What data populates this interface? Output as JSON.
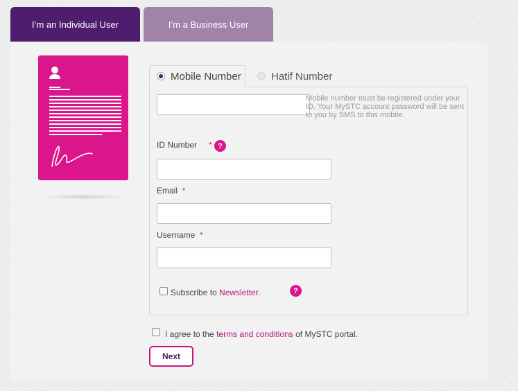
{
  "tabs": {
    "individual": "I’m an Individual User",
    "business": "I’m a Business User"
  },
  "subtabs": {
    "mobile": "Mobile Number",
    "hatif": "Hatif Number"
  },
  "form": {
    "mobile_hint": "Mobile number must be registered under your ID. Your MySTC account password will be sent to you by SMS to this mobile.",
    "id_label": "ID Number",
    "email_label": "Email",
    "username_label": "Username",
    "required_mark": "*",
    "help_glyph": "?",
    "newsletter_prefix": "Subscribe to ",
    "newsletter_link": "Newsletter",
    "newsletter_suffix": ".",
    "terms_prefix": "I agree to the ",
    "terms_link": "terms and conditions",
    "terms_suffix": " of MySTC portal."
  },
  "buttons": {
    "next": "Next"
  },
  "icons": {
    "card": "id-card-icon",
    "help": "help-icon"
  },
  "colors": {
    "primary_purple": "#4f1d6e",
    "secondary_tab": "#a083a8",
    "accent_magenta": "#db168c",
    "link": "#b0177a"
  }
}
